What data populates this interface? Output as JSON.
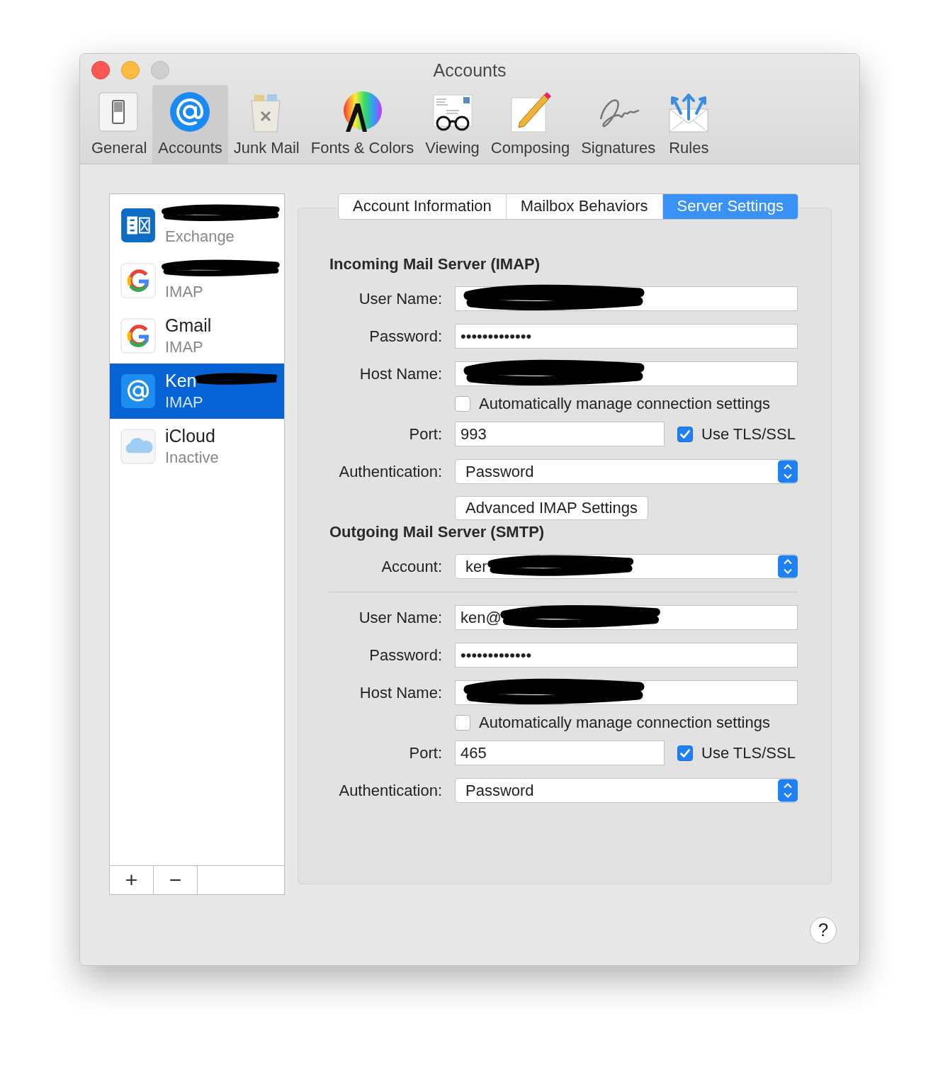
{
  "window": {
    "title": "Accounts"
  },
  "toolbar": [
    {
      "label": "General",
      "kind": "general",
      "selected": false
    },
    {
      "label": "Accounts",
      "kind": "accounts",
      "selected": true
    },
    {
      "label": "Junk Mail",
      "kind": "junk",
      "selected": false
    },
    {
      "label": "Fonts & Colors",
      "kind": "fonts",
      "selected": false
    },
    {
      "label": "Viewing",
      "kind": "viewing",
      "selected": false
    },
    {
      "label": "Composing",
      "kind": "composing",
      "selected": false
    },
    {
      "label": "Signatures",
      "kind": "signatures",
      "selected": false
    },
    {
      "label": "Rules",
      "kind": "rules",
      "selected": false
    }
  ],
  "accounts": [
    {
      "kind": "exchange",
      "subtitle": "Exchange",
      "redacted": true,
      "selected": false
    },
    {
      "kind": "google",
      "subtitle": "IMAP",
      "redacted": true,
      "selected": false
    },
    {
      "kind": "google",
      "name": "Gmail",
      "subtitle": "IMAP",
      "redacted": false,
      "selected": false
    },
    {
      "kind": "mail",
      "name": "Ken",
      "subtitle": "IMAP",
      "redacted": true,
      "selected": true
    },
    {
      "kind": "icloud",
      "name": "iCloud",
      "subtitle": "Inactive",
      "redacted": false,
      "selected": false
    }
  ],
  "list_buttons": [
    "+",
    "−"
  ],
  "tabs": [
    {
      "label": "Account Information",
      "selected": false
    },
    {
      "label": "Mailbox Behaviors",
      "selected": false
    },
    {
      "label": "Server Settings",
      "selected": true
    }
  ],
  "sections": [
    {
      "title": "Incoming Mail Server (IMAP)",
      "rows": [
        {
          "kind": "text",
          "label": "User Name:",
          "redacted": true
        },
        {
          "kind": "password",
          "label": "Password:",
          "value": "•••••••••••••"
        },
        {
          "kind": "text",
          "label": "Host Name:",
          "redacted": true
        },
        {
          "kind": "checkbox",
          "label": "Automatically manage connection settings",
          "checked": false
        },
        {
          "kind": "port",
          "label": "Port:",
          "value": "993",
          "option": "Use TLS/SSL",
          "checked": true
        },
        {
          "kind": "select",
          "label": "Authentication:",
          "value": "Password"
        },
        {
          "kind": "button",
          "label": "Advanced IMAP Settings"
        }
      ]
    },
    {
      "title": "Outgoing Mail Server (SMTP)",
      "rows": [
        {
          "kind": "select",
          "label": "Account:",
          "value": "ker",
          "redacted": true
        },
        {
          "kind": "separator"
        },
        {
          "kind": "text",
          "label": "User Name:",
          "value": "ken@",
          "redacted": true
        },
        {
          "kind": "password",
          "label": "Password:",
          "value": "•••••••••••••"
        },
        {
          "kind": "text",
          "label": "Host Name:",
          "redacted": true
        },
        {
          "kind": "checkbox",
          "label": "Automatically manage connection settings",
          "checked": false
        },
        {
          "kind": "port",
          "label": "Port:",
          "value": "465",
          "option": "Use TLS/SSL",
          "checked": true
        },
        {
          "kind": "select",
          "label": "Authentication:",
          "value": "Password"
        }
      ]
    }
  ],
  "help_button": "?"
}
